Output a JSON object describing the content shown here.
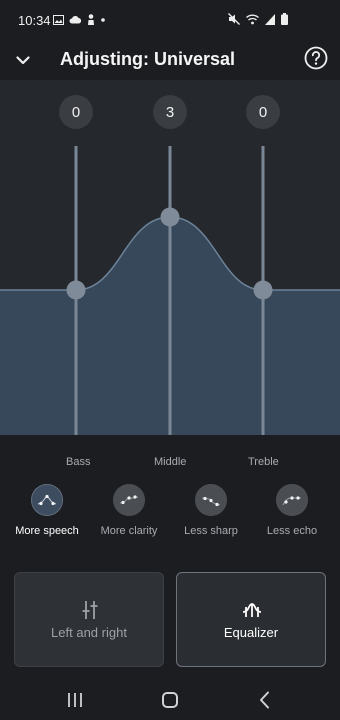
{
  "status": {
    "time": "10:34"
  },
  "header": {
    "title": "Adjusting: Universal"
  },
  "bands": [
    {
      "name": "Bass",
      "value": "0",
      "level": 0
    },
    {
      "name": "Middle",
      "value": "3",
      "level": 3
    },
    {
      "name": "Treble",
      "value": "0",
      "level": 0
    }
  ],
  "presets": [
    {
      "label": "More speech",
      "selected": true
    },
    {
      "label": "More clarity",
      "selected": false
    },
    {
      "label": "Less sharp",
      "selected": false
    },
    {
      "label": "Less echo",
      "selected": false
    }
  ],
  "modes": [
    {
      "label": "Left and right",
      "icon": "sliders-icon",
      "selected": false
    },
    {
      "label": "Equalizer",
      "icon": "equalizer-icon",
      "selected": true
    }
  ],
  "colors": {
    "background": "#1b1d21",
    "eq_fill": "#37485a",
    "eq_line": "#6c8399",
    "knob": "#7f8b98"
  }
}
